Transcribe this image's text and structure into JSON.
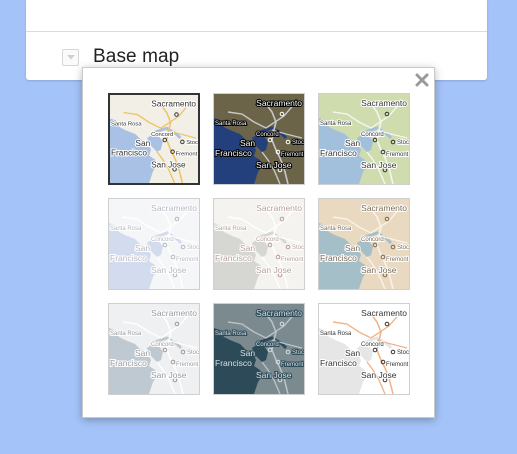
{
  "layer_panel": {
    "title": "Base map"
  },
  "basemap_picker": {
    "selected_index": 0,
    "thumbnail_labels": {
      "sacramento": "Sacramento",
      "santa_rosa": "Santa Rosa",
      "concord": "Concord",
      "san": "San",
      "francisco": "Francisco",
      "stoc": "Stoc",
      "fremont": "Fremont",
      "san_jose": "San Jose"
    },
    "styles": [
      {
        "id": "roadmap",
        "water": "#a9c1e4",
        "land": "#f2efe6",
        "road": "#f0c36a",
        "text": "#333333",
        "halo": "#ffffff"
      },
      {
        "id": "satellite",
        "water": "#24407c",
        "land": "#6b6448",
        "road": "#c8c8c8",
        "text": "#ffffff",
        "halo": "#000000"
      },
      {
        "id": "terrain",
        "water": "#a2bfdc",
        "land": "#cfdcae",
        "road": "#f5f5f0",
        "text": "#333333",
        "halo": "#ffffff"
      },
      {
        "id": "light-blue",
        "water": "#d3dcef",
        "land": "#f5f6f8",
        "road": "#ffffff",
        "text": "#b4b8c2",
        "halo": "#ffffff"
      },
      {
        "id": "light-gray",
        "water": "#d6d6d2",
        "land": "#f4f3f0",
        "road": "#ffffff",
        "text": "#b79d9d",
        "halo": "#ffffff"
      },
      {
        "id": "atlas",
        "water": "#a5bfc9",
        "land": "#ead9c1",
        "road": "#f9f2e6",
        "text": "#7a6a55",
        "halo": "#ffffff"
      },
      {
        "id": "muted-gray",
        "water": "#bfc9d1",
        "land": "#eef0f1",
        "road": "#ffffff",
        "text": "#999999",
        "halo": "#ffffff"
      },
      {
        "id": "dark",
        "water": "#2c4a57",
        "land": "#7a8a8f",
        "road": "#b9c2c6",
        "text": "#d8e0e3",
        "halo": "#2c4a57"
      },
      {
        "id": "high-contrast",
        "water": "#e6e6e6",
        "land": "#ffffff",
        "road": "#f1b58a",
        "text": "#333333",
        "halo": "#ffffff"
      }
    ]
  },
  "colors": {
    "background": "#a4c3f8",
    "panel": "#ffffff",
    "selected_border": "#333333"
  },
  "icons": {
    "toggle": "chevron-down-icon",
    "close": "close-icon"
  }
}
